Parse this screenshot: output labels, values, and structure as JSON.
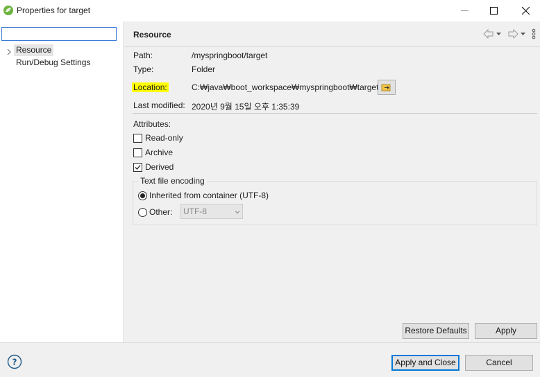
{
  "window": {
    "title": "Properties for target",
    "min_icon": "minimize-icon",
    "max_icon": "maximize-icon",
    "close_icon": "close-icon"
  },
  "sidebar": {
    "filter": {
      "value": "",
      "placeholder": ""
    },
    "items": [
      {
        "label": "Resource",
        "selected": true,
        "expandable": true
      },
      {
        "label": "Run/Debug Settings",
        "selected": false,
        "expandable": false
      }
    ]
  },
  "resource": {
    "title": "Resource",
    "nav_icons": [
      "back-arrow-icon",
      "back-dropdown-icon",
      "forward-arrow-icon",
      "forward-dropdown-icon",
      "more-vertical-icon"
    ],
    "props": {
      "path_label": "Path:",
      "path_value": "/myspringboot/target",
      "type_label": "Type:",
      "type_value": "Folder",
      "location_label": "Location:",
      "location_value": "C:₩java₩boot_workspace₩myspringboot₩target",
      "modified_label": "Last modified:",
      "modified_value": "2020년 9월 15일 오후 1:35:39"
    },
    "location_highlight_color": "#ffff00",
    "attributes": {
      "label": "Attributes:",
      "readonly": {
        "label": "Read-only",
        "checked": false
      },
      "archive": {
        "label": "Archive",
        "checked": false
      },
      "derived": {
        "label": "Derived",
        "checked": true
      }
    },
    "encoding": {
      "legend": "Text file encoding",
      "inherited_label": "Inherited from container (UTF-8)",
      "other_label": "Other:",
      "other_value": "UTF-8",
      "selected": "inherited"
    },
    "restore_defaults": "Restore Defaults",
    "apply": "Apply"
  },
  "footer": {
    "apply_close": "Apply and Close",
    "cancel": "Cancel",
    "help_icon": "help-icon"
  },
  "colors": {
    "accent": "#0078d7",
    "panel": "#f0f0f0",
    "app_icon_green": "#6db33f"
  }
}
